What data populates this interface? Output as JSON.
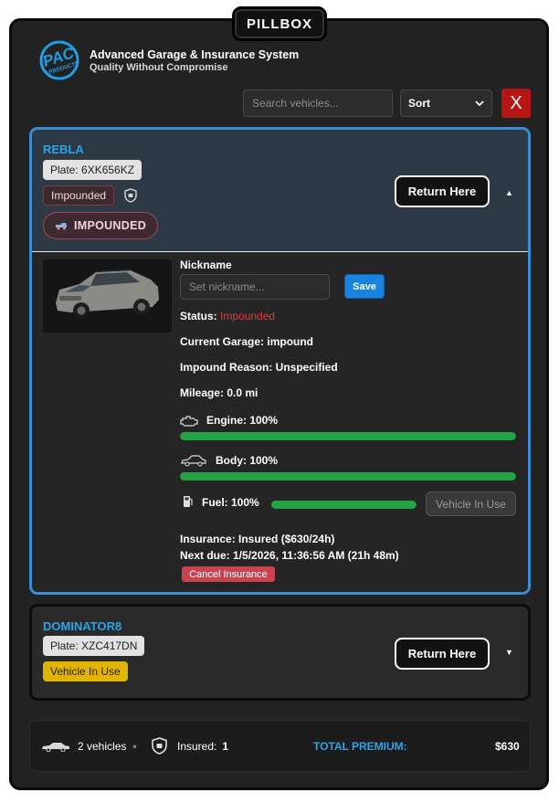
{
  "app": {
    "tab_title": "PILLBOX",
    "logo_text": "PAC PRODUCTS",
    "title": "Advanced Garage & Insurance System",
    "subtitle": "Quality Without Compromise"
  },
  "toolbar": {
    "search_placeholder": "Search vehicles...",
    "sort_label": "Sort",
    "close_label": "X"
  },
  "vehicles": [
    {
      "name": "REBLA",
      "plate": "Plate: 6XK656KZ",
      "status_tag": "Impounded",
      "status_pill": "IMPOUNDED",
      "return_label": "Return Here",
      "expanded": true,
      "details": {
        "nickname_label": "Nickname",
        "nickname_placeholder": "Set nickname...",
        "save_label": "Save",
        "status_label": "Status:",
        "status_value": "Impounded",
        "garage": "Current Garage: impound",
        "impound_reason": "Impound Reason: Unspecified",
        "mileage": "Mileage: 0.0 mi",
        "engine_label": "Engine: 100%",
        "engine_value": 100,
        "body_label": "Body: 100%",
        "body_value": 100,
        "fuel_label": "Fuel: 100%",
        "fuel_value": 100,
        "in_use_label": "Vehicle In Use",
        "insurance": "Insurance: Insured ($630/24h)",
        "next_due": "Next due: 1/5/2026, 11:36:56 AM (21h 48m)",
        "cancel_label": "Cancel Insurance"
      }
    },
    {
      "name": "DOMINATOR8",
      "plate": "Plate: XZC417DN",
      "status_tag": "Vehicle In Use",
      "return_label": "Return Here",
      "expanded": false
    }
  ],
  "footer": {
    "vehicle_count": "2 vehicles",
    "separator": "•",
    "insured_label": "Insured:",
    "insured_count": "1",
    "total_label": "TOTAL PREMIUM:",
    "total_value": "$630"
  },
  "colors": {
    "accent": "#2ba4e8",
    "danger": "#b81515",
    "success": "#25a244",
    "warning": "#e0b400"
  }
}
